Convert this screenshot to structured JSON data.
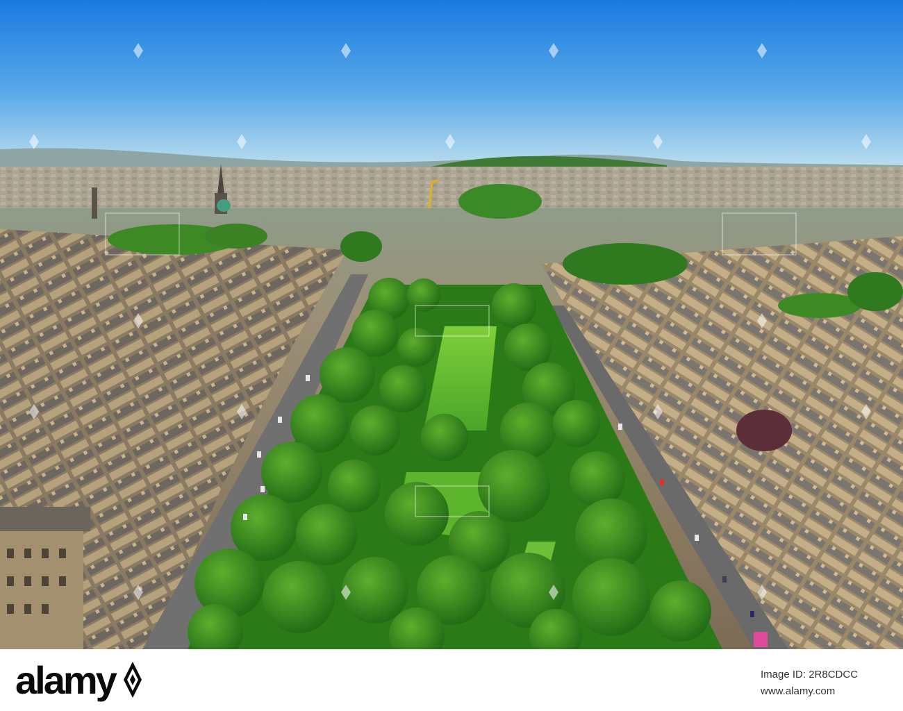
{
  "photo": {
    "subject": "aerial-city-park",
    "colors": {
      "sky_top": "#1e7fe0",
      "sky_horizon": "#b6dcef",
      "park": "#2f8a1e",
      "stone": "#a38d6b"
    }
  },
  "footer": {
    "logo_text": "alamy",
    "image_id_text": "Image ID: 2R8CDCC",
    "url_text": "www.alamy.com"
  }
}
